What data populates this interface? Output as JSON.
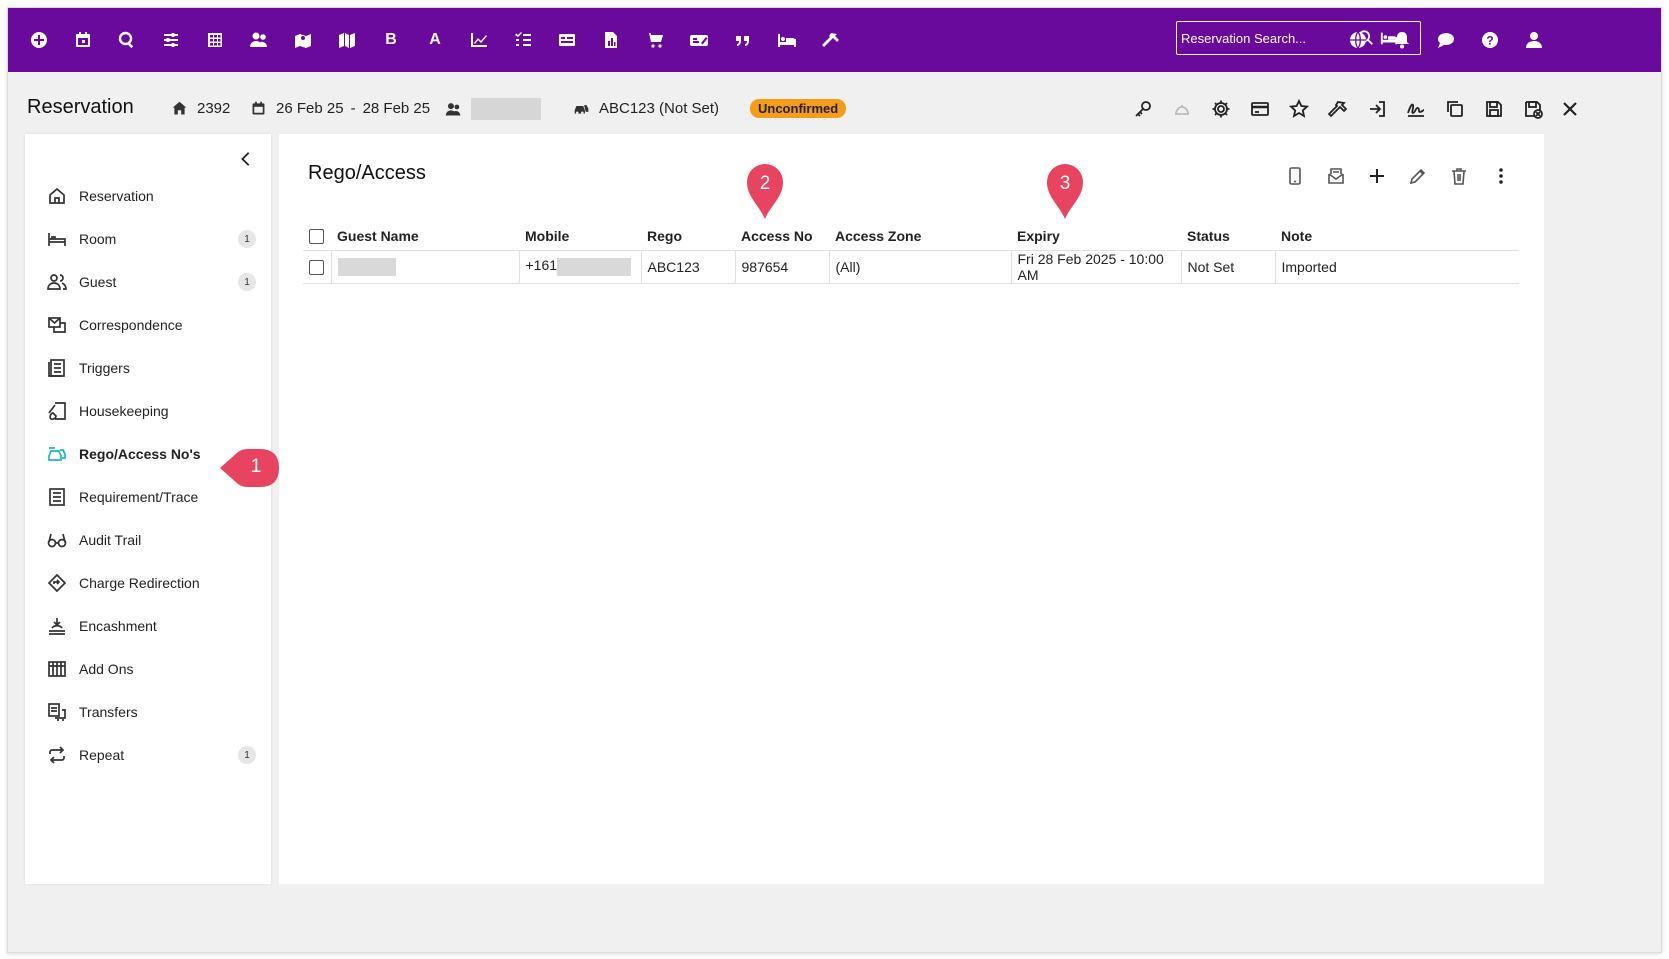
{
  "topbar": {
    "icons": [
      "plus-circle-icon",
      "calendar-icon",
      "search-icon",
      "sliders-icon",
      "grid-icon",
      "users-icon",
      "map-pin-icon",
      "map-icon",
      "bold-b-icon",
      "letter-a-icon",
      "chart-line-icon",
      "checklist-icon",
      "card-icon",
      "report-icon",
      "cart-icon",
      "ticket-icon",
      "quote-icon",
      "bed-icon",
      "hammer-icon"
    ],
    "letters": {
      "b": "B",
      "a": "A"
    },
    "search_placeholder": "Reservation Search...",
    "right_icons": [
      "globe-icon",
      "bell-icon",
      "chat-icon",
      "help-icon",
      "user-icon"
    ]
  },
  "header": {
    "title": "Reservation",
    "property_number": "2392",
    "date_from": "26 Feb 25",
    "date_sep": "-",
    "date_to": "28 Feb 25",
    "vehicle": "ABC123 (Not Set)",
    "status_badge": "Unconfirmed",
    "status_color": "#f59c1a"
  },
  "sidebar": {
    "items": [
      {
        "label": "Reservation",
        "icon": "home-icon",
        "count": ""
      },
      {
        "label": "Room",
        "icon": "bed-icon",
        "count": "1"
      },
      {
        "label": "Guest",
        "icon": "users-icon",
        "count": "1"
      },
      {
        "label": "Correspondence",
        "icon": "correspondence-icon",
        "count": ""
      },
      {
        "label": "Triggers",
        "icon": "triggers-icon",
        "count": ""
      },
      {
        "label": "Housekeeping",
        "icon": "housekeeping-icon",
        "count": ""
      },
      {
        "label": "Rego/Access No's",
        "icon": "car-icon",
        "count": ""
      },
      {
        "label": "Requirement/Trace",
        "icon": "list-icon",
        "count": ""
      },
      {
        "label": "Audit Trail",
        "icon": "glasses-icon",
        "count": ""
      },
      {
        "label": "Charge Redirection",
        "icon": "redirect-icon",
        "count": ""
      },
      {
        "label": "Encashment",
        "icon": "encashment-icon",
        "count": ""
      },
      {
        "label": "Add Ons",
        "icon": "addons-icon",
        "count": ""
      },
      {
        "label": "Transfers",
        "icon": "transfers-icon",
        "count": ""
      },
      {
        "label": "Repeat",
        "icon": "repeat-icon",
        "count": "1"
      }
    ]
  },
  "main": {
    "title": "Rego/Access",
    "actions": [
      "mobile-icon",
      "email-icon",
      "add-icon",
      "edit-icon",
      "delete-icon",
      "more-icon"
    ],
    "table": {
      "headers": [
        "Guest Name",
        "Mobile",
        "Rego",
        "Access No",
        "Access Zone",
        "Expiry",
        "Status",
        "Note"
      ],
      "rows": [
        {
          "guest_name": "",
          "mobile": "+161",
          "rego": "ABC123",
          "access_no": "987654",
          "access_zone": "(All)",
          "expiry": "Fri 28 Feb 2025 - 10:00 AM",
          "status": "Not Set",
          "note": "Imported"
        }
      ]
    }
  },
  "callouts": {
    "one": "1",
    "two": "2",
    "three": "3",
    "color": "#e8435f"
  }
}
